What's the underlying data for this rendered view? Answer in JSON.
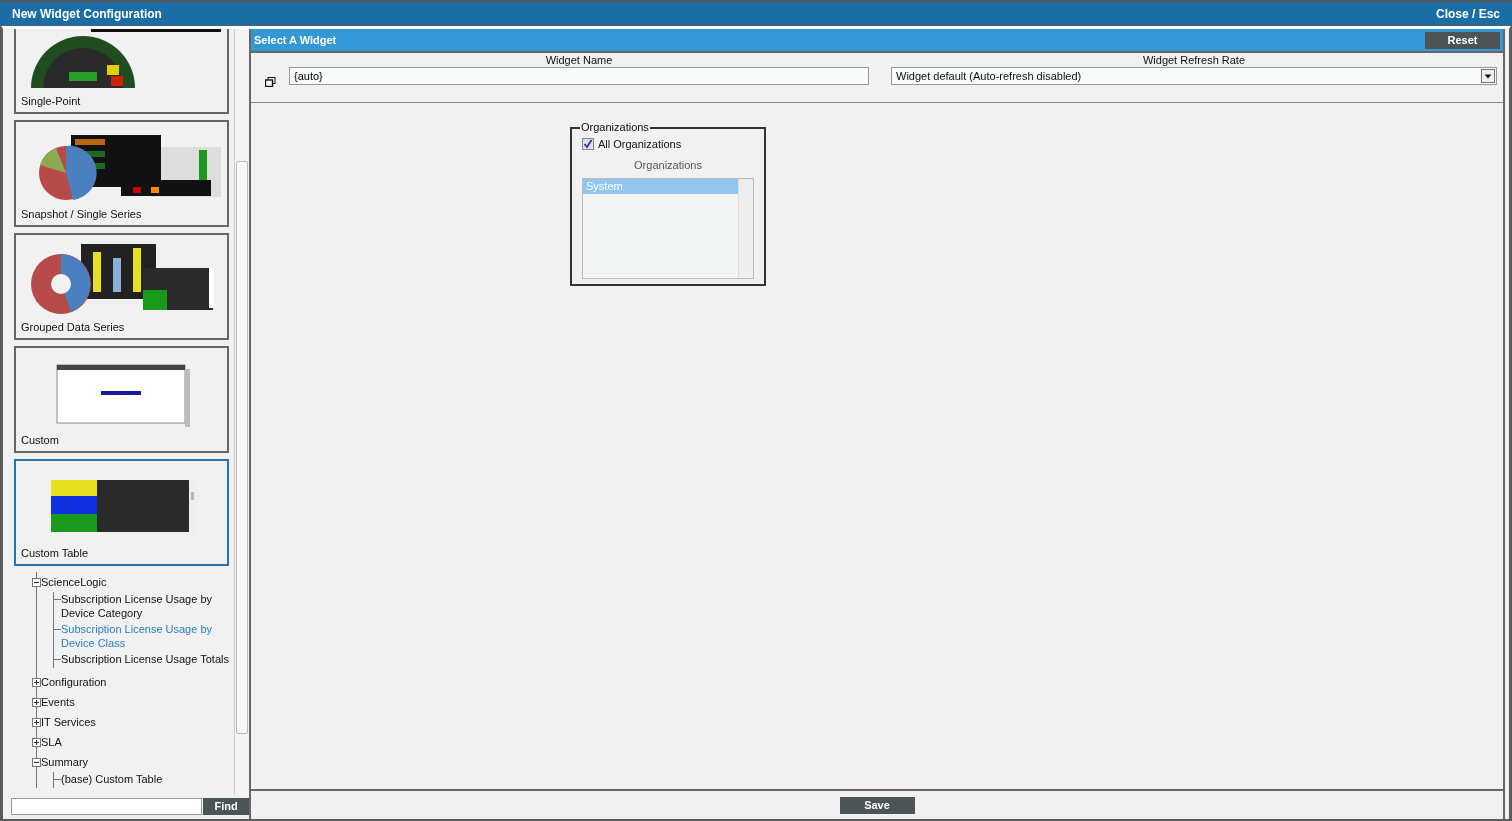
{
  "window": {
    "title": "New Widget Configuration",
    "close": "Close / Esc"
  },
  "widget_types": [
    {
      "label": "Single-Point",
      "selected": false
    },
    {
      "label": "Snapshot / Single Series",
      "selected": false
    },
    {
      "label": "Grouped Data Series",
      "selected": false
    },
    {
      "label": "Custom",
      "selected": false
    },
    {
      "label": "Custom Table",
      "selected": true
    }
  ],
  "tree": [
    {
      "label": "ScienceLogic",
      "expanded": true,
      "children": [
        {
          "label": "Subscription License Usage by Device Category",
          "selected": false
        },
        {
          "label": "Subscription License Usage by Device Class",
          "selected": true
        },
        {
          "label": "Subscription License Usage Totals",
          "selected": false
        }
      ]
    },
    {
      "label": "Configuration",
      "expanded": false
    },
    {
      "label": "Events",
      "expanded": false
    },
    {
      "label": "IT Services",
      "expanded": false
    },
    {
      "label": "SLA",
      "expanded": false
    },
    {
      "label": "Summary",
      "expanded": true,
      "children": [
        {
          "label": "(base) Custom Table",
          "selected": false
        }
      ]
    }
  ],
  "find": {
    "button": "Find"
  },
  "panel": {
    "title": "Select A Widget",
    "reset": "Reset",
    "widget_name": {
      "label": "Widget Name",
      "value": "{auto}"
    },
    "refresh_rate": {
      "label": "Widget Refresh Rate",
      "value": "Widget default (Auto-refresh disabled)"
    },
    "organizations": {
      "legend": "Organizations",
      "all": {
        "label": "All Organizations",
        "checked": true
      },
      "list_label": "Organizations",
      "items": [
        {
          "label": "System",
          "selected": true
        }
      ]
    },
    "save": "Save"
  }
}
